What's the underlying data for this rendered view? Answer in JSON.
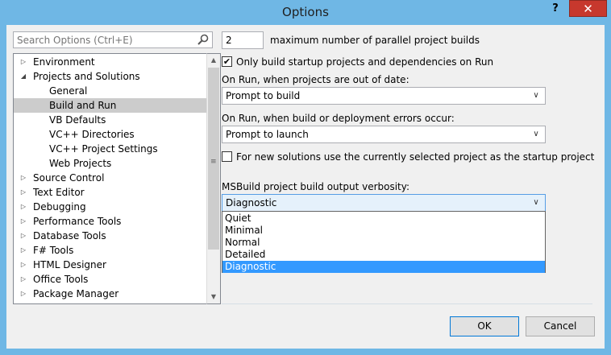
{
  "window": {
    "title": "Options",
    "help_glyph": "?",
    "close_glyph": "✕"
  },
  "search": {
    "placeholder": "Search Options (Ctrl+E)"
  },
  "tree": {
    "items": [
      {
        "label": "Environment",
        "expander": "▷",
        "level": 0
      },
      {
        "label": "Projects and Solutions",
        "expander": "◢",
        "level": 0
      },
      {
        "label": "General",
        "expander": "",
        "level": 1
      },
      {
        "label": "Build and Run",
        "expander": "",
        "level": 1,
        "selected": true
      },
      {
        "label": "VB Defaults",
        "expander": "",
        "level": 1
      },
      {
        "label": "VC++ Directories",
        "expander": "",
        "level": 1
      },
      {
        "label": "VC++ Project Settings",
        "expander": "",
        "level": 1
      },
      {
        "label": "Web Projects",
        "expander": "",
        "level": 1
      },
      {
        "label": "Source Control",
        "expander": "▷",
        "level": 0
      },
      {
        "label": "Text Editor",
        "expander": "▷",
        "level": 0
      },
      {
        "label": "Debugging",
        "expander": "▷",
        "level": 0
      },
      {
        "label": "Performance Tools",
        "expander": "▷",
        "level": 0
      },
      {
        "label": "Database Tools",
        "expander": "▷",
        "level": 0
      },
      {
        "label": "F# Tools",
        "expander": "▷",
        "level": 0
      },
      {
        "label": "HTML Designer",
        "expander": "▷",
        "level": 0
      },
      {
        "label": "Office Tools",
        "expander": "▷",
        "level": 0
      },
      {
        "label": "Package Manager",
        "expander": "▷",
        "level": 0
      }
    ]
  },
  "settings": {
    "parallel_builds_value": "2",
    "parallel_builds_label": "maximum number of parallel project builds",
    "only_build_startup_label": "Only build startup projects and dependencies on Run",
    "only_build_startup_checked": "✔",
    "out_of_date_label": "On Run, when projects are out of date:",
    "out_of_date_value": "Prompt to build",
    "errors_label": "On Run, when build or deployment errors occur:",
    "errors_value": "Prompt to launch",
    "new_solutions_label": "For new solutions use the currently selected project as the startup project",
    "new_solutions_checked": "",
    "verbosity_label": "MSBuild project build output verbosity:",
    "verbosity_value": "Diagnostic",
    "verbosity_options": [
      "Quiet",
      "Minimal",
      "Normal",
      "Detailed",
      "Diagnostic"
    ],
    "verbosity_selected_index": 4
  },
  "buttons": {
    "ok": "OK",
    "cancel": "Cancel"
  },
  "colors": {
    "titlebar": "#6fb7e5",
    "close_button": "#c7382d",
    "selection": "#3399ff"
  }
}
